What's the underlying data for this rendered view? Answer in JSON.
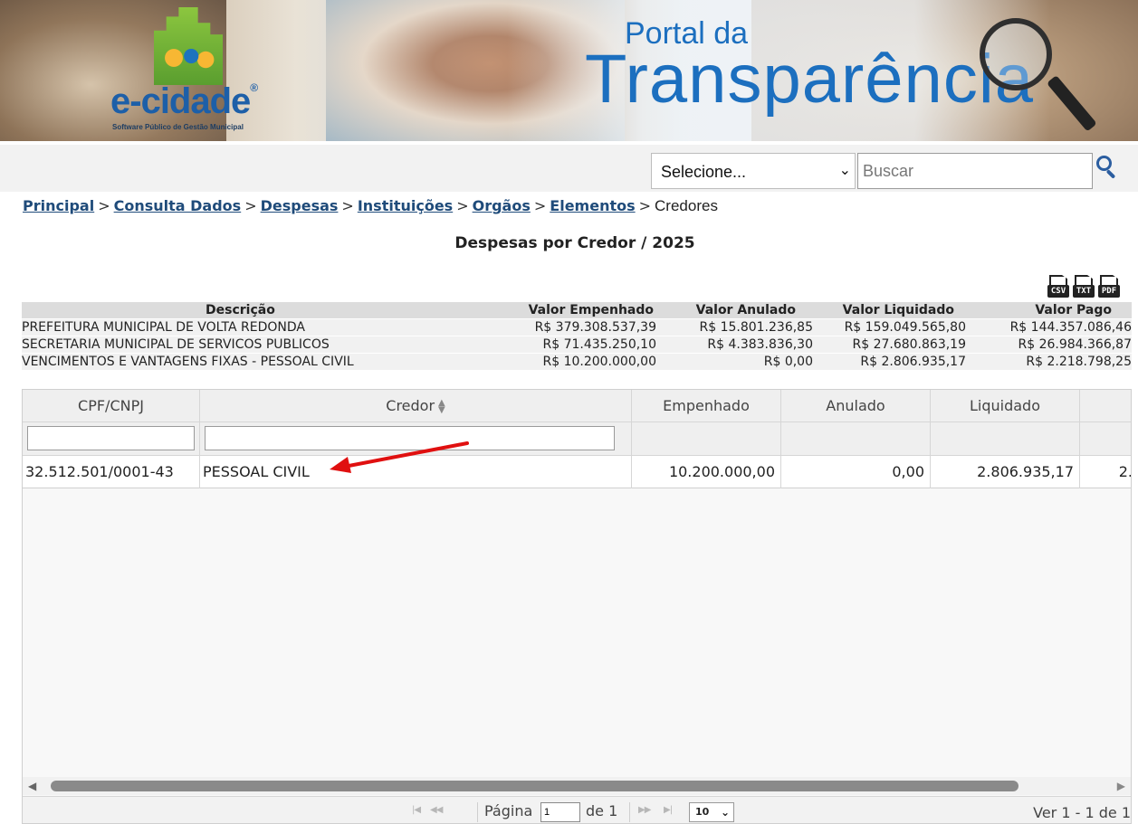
{
  "banner": {
    "logo_name": "e-cidade",
    "logo_reg": "®",
    "logo_tagline": "Software Público de Gestão Municipal",
    "portal_line1": "Portal da",
    "portal_line2": "Transparência"
  },
  "search": {
    "select_value": "Selecione...",
    "placeholder": "Buscar"
  },
  "breadcrumb": {
    "items": [
      "Principal",
      "Consulta Dados",
      "Despesas",
      "Instituições",
      "Orgãos",
      "Elementos"
    ],
    "current": "Credores",
    "separator": ">"
  },
  "page_title": "Despesas por Credor / 2025",
  "exports": [
    "CSV",
    "TXT",
    "PDF"
  ],
  "summary": {
    "headers": [
      "Descrição",
      "Valor Empenhado",
      "Valor Anulado",
      "Valor Liquidado",
      "Valor Pago"
    ],
    "rows": [
      [
        "PREFEITURA MUNICIPAL DE VOLTA REDONDA",
        "R$ 379.308.537,39",
        "R$ 15.801.236,85",
        "R$ 159.049.565,80",
        "R$ 144.357.086,46"
      ],
      [
        "SECRETARIA MUNICIPAL DE SERVICOS PUBLICOS",
        "R$ 71.435.250,10",
        "R$ 4.383.836,30",
        "R$ 27.680.863,19",
        "R$ 26.984.366,87"
      ],
      [
        "VENCIMENTOS E VANTAGENS FIXAS - PESSOAL CIVIL",
        "R$ 10.200.000,00",
        "R$ 0,00",
        "R$ 2.806.935,17",
        "R$ 2.218.798,25"
      ]
    ]
  },
  "grid": {
    "columns": [
      "CPF/CNPJ",
      "Credor",
      "Empenhado",
      "Anulado",
      "Liquidado"
    ],
    "rows": [
      {
        "cpf_cnpj": "32.512.501/0001-43",
        "credor": "PESSOAL CIVIL",
        "empenhado": "10.200.000,00",
        "anulado": "0,00",
        "liquidado": "2.806.935,17",
        "pago_partial": "2."
      }
    ]
  },
  "pager": {
    "page_label": "Página",
    "page_value": "1",
    "of_label": "de 1",
    "rows_per_page": "10",
    "view_text": "Ver 1 - 1 de 1"
  },
  "colors": {
    "link": "#1f4b7a",
    "brand_blue": "#1c6fbf",
    "annotation_arrow": "#e01010"
  }
}
